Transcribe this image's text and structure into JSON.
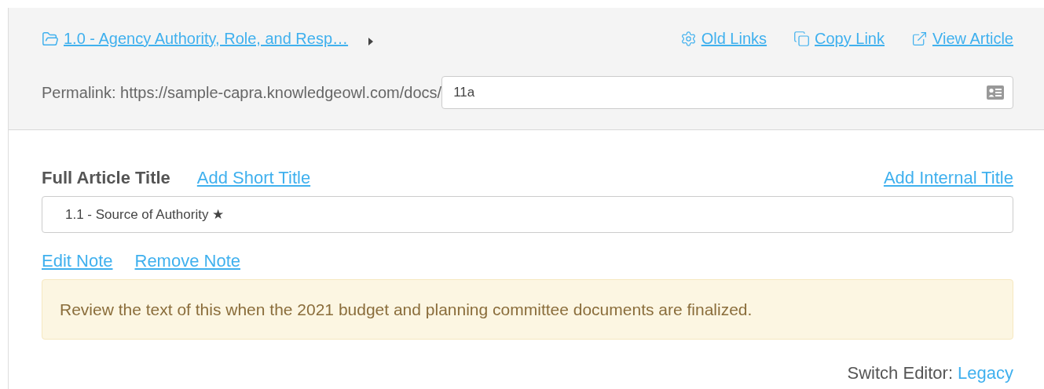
{
  "breadcrumb": {
    "label": "1.0 - Agency Authority, Role, and Resp…"
  },
  "header_links": [
    {
      "label": "Old Links",
      "kind": "gear"
    },
    {
      "label": "Copy Link",
      "kind": "copy"
    },
    {
      "label": "View Article",
      "kind": "external"
    }
  ],
  "permalink": {
    "label": "Permalink: https://sample-capra.knowledgeowl.com/docs/",
    "value": "11a"
  },
  "title_section": {
    "label": "Full Article Title",
    "add_short_title": "Add Short Title",
    "add_internal_title": "Add Internal Title",
    "value": "1.1 - Source of Authority ★"
  },
  "note_links": [
    "Edit Note",
    "Remove Note"
  ],
  "note": "Review the text of this when the 2021 budget and planning committee documents are finalized.",
  "switch_editor": {
    "label": "Switch Editor:",
    "link": "Legacy"
  }
}
